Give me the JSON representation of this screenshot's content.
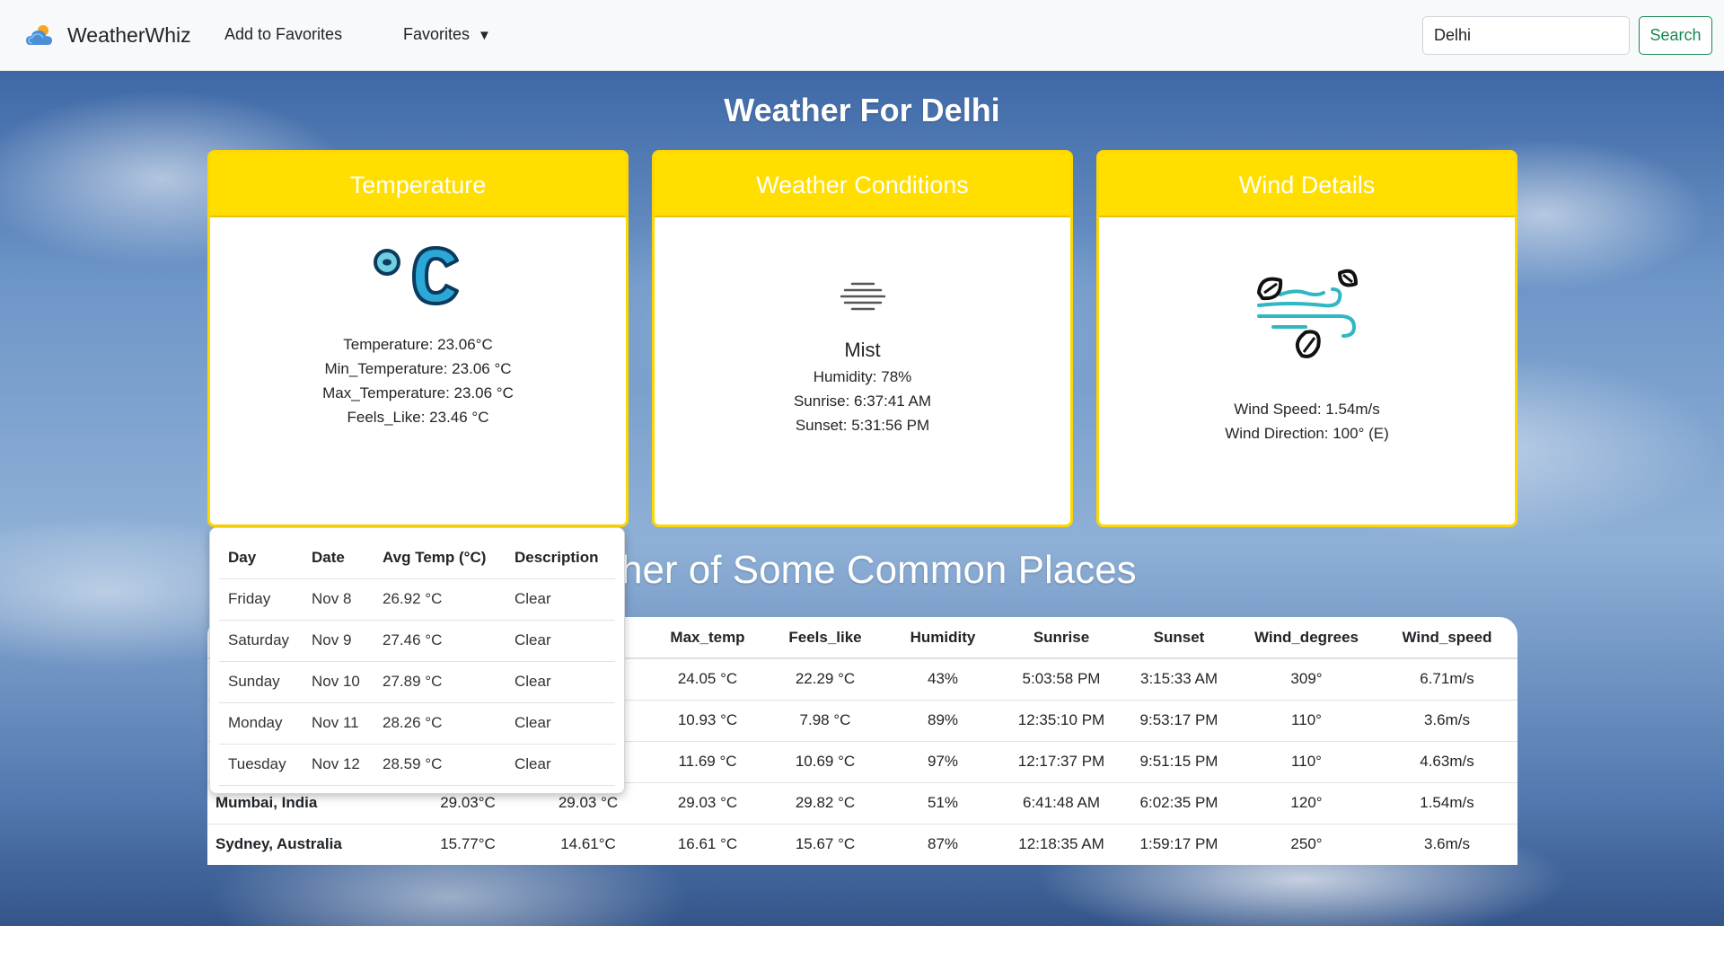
{
  "nav": {
    "brand": "WeatherWhiz",
    "add_favorites": "Add to Favorites",
    "favorites": "Favorites",
    "favorites_caret": "▼",
    "search_value": "Delhi",
    "search_button": "Search"
  },
  "hero": {
    "title": "Weather For Delhi"
  },
  "cards": {
    "temperature": {
      "header": "Temperature",
      "lines": [
        "Temperature: 23.06°C",
        "Min_Temperature: 23.06 °C",
        "Max_Temperature: 23.06 °C",
        "Feels_Like: 23.46 °C"
      ]
    },
    "conditions": {
      "header": "Weather Conditions",
      "main": "Mist",
      "lines": [
        "Humidity: 78%",
        "Sunrise: 6:37:41 AM",
        "Sunset: 5:31:56 PM"
      ]
    },
    "wind": {
      "header": "Wind Details",
      "lines": [
        "Wind Speed: 1.54m/s",
        "Wind Direction: 100° (E)"
      ]
    }
  },
  "common": {
    "title": "ather of Some Common Places",
    "headers": [
      "",
      "",
      "mp",
      "Max_temp",
      "Feels_like",
      "Humidity",
      "Sunrise",
      "Sunset",
      "Wind_degrees",
      "Wind_speed"
    ],
    "rows": [
      {
        "place": "",
        "temp": "",
        "min": "°C",
        "max": "24.05 °C",
        "feels": "22.29 °C",
        "humidity": "43%",
        "sunrise": "5:03:58 PM",
        "sunset": "3:15:33 AM",
        "deg": "309°",
        "speed": "6.71m/s"
      },
      {
        "place": "",
        "temp": "",
        "min": "°C",
        "max": "10.93 °C",
        "feels": "7.98 °C",
        "humidity": "89%",
        "sunrise": "12:35:10 PM",
        "sunset": "9:53:17 PM",
        "deg": "110°",
        "speed": "3.6m/s"
      },
      {
        "place": "",
        "temp": "",
        "min": "°C",
        "max": "11.69 °C",
        "feels": "10.69 °C",
        "humidity": "97%",
        "sunrise": "12:17:37 PM",
        "sunset": "9:51:15 PM",
        "deg": "110°",
        "speed": "4.63m/s"
      },
      {
        "place": "Mumbai, India",
        "temp": "29.03°C",
        "min": "29.03 °C",
        "max": "29.03 °C",
        "feels": "29.82 °C",
        "humidity": "51%",
        "sunrise": "6:41:48 AM",
        "sunset": "6:02:35 PM",
        "deg": "120°",
        "speed": "1.54m/s"
      },
      {
        "place": "Sydney, Australia",
        "temp": "15.77°C",
        "min": "14.61°C",
        "max": "16.61 °C",
        "feels": "15.67 °C",
        "humidity": "87%",
        "sunrise": "12:18:35 AM",
        "sunset": "1:59:17 PM",
        "deg": "250°",
        "speed": "3.6m/s"
      }
    ]
  },
  "forecast": {
    "headers": [
      "Day",
      "Date",
      "Avg Temp (°C)",
      "Description"
    ],
    "rows": [
      {
        "day": "Friday",
        "date": "Nov 8",
        "avg": "26.92 °C",
        "desc": "Clear"
      },
      {
        "day": "Saturday",
        "date": "Nov 9",
        "avg": "27.46 °C",
        "desc": "Clear"
      },
      {
        "day": "Sunday",
        "date": "Nov 10",
        "avg": "27.89 °C",
        "desc": "Clear"
      },
      {
        "day": "Monday",
        "date": "Nov 11",
        "avg": "28.26 °C",
        "desc": "Clear"
      },
      {
        "day": "Tuesday",
        "date": "Nov 12",
        "avg": "28.59 °C",
        "desc": "Clear"
      }
    ]
  },
  "colors": {
    "card_header": "#ffde00",
    "card_border": "#ffd700",
    "search_accent": "#198754",
    "icon_teal": "#2fb7c4",
    "icon_blue": "#1f8fd0"
  },
  "icons": {
    "brand": "cloud-sun-icon",
    "temperature": "celsius-icon",
    "conditions": "mist-icon",
    "wind": "wind-leaves-icon"
  }
}
